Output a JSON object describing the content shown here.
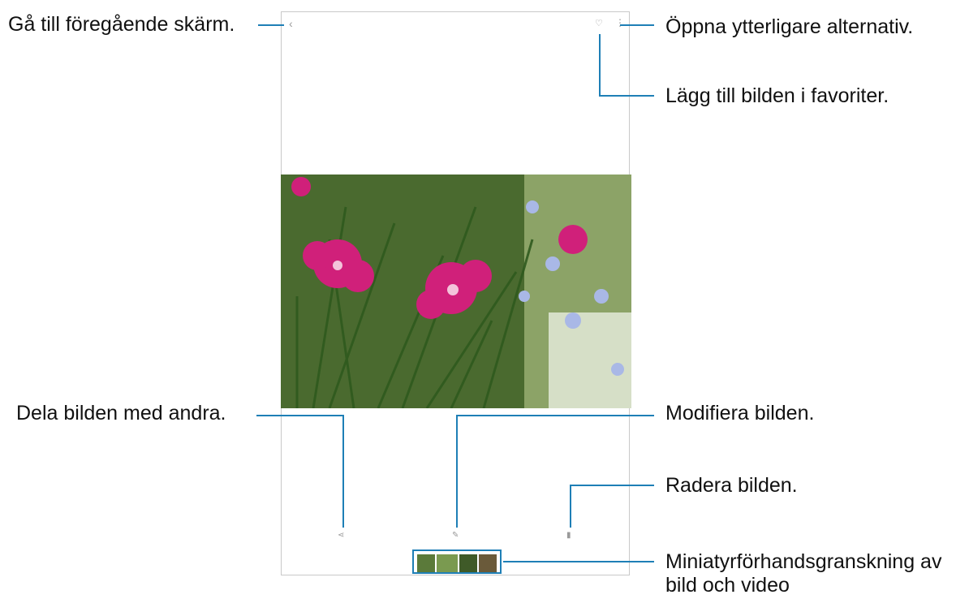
{
  "annotations": {
    "back": "Gå till föregående skärm.",
    "more": "Öppna ytterligare alternativ.",
    "favorite": "Lägg till bilden i favoriter.",
    "share": "Dela bilden med andra.",
    "edit": "Modifiera bilden.",
    "delete": "Radera bilden.",
    "thumbnails_line1": "Miniatyrförhandsgranskning av",
    "thumbnails_line2": "bild och video"
  },
  "icons": {
    "back": "chevron-left-icon",
    "favorite": "heart-icon",
    "more": "more-vertical-icon",
    "share": "share-icon",
    "edit": "pencil-icon",
    "delete": "trash-icon"
  },
  "colors": {
    "callout_line": "#1e7fb6",
    "flower": "#d0207a"
  }
}
